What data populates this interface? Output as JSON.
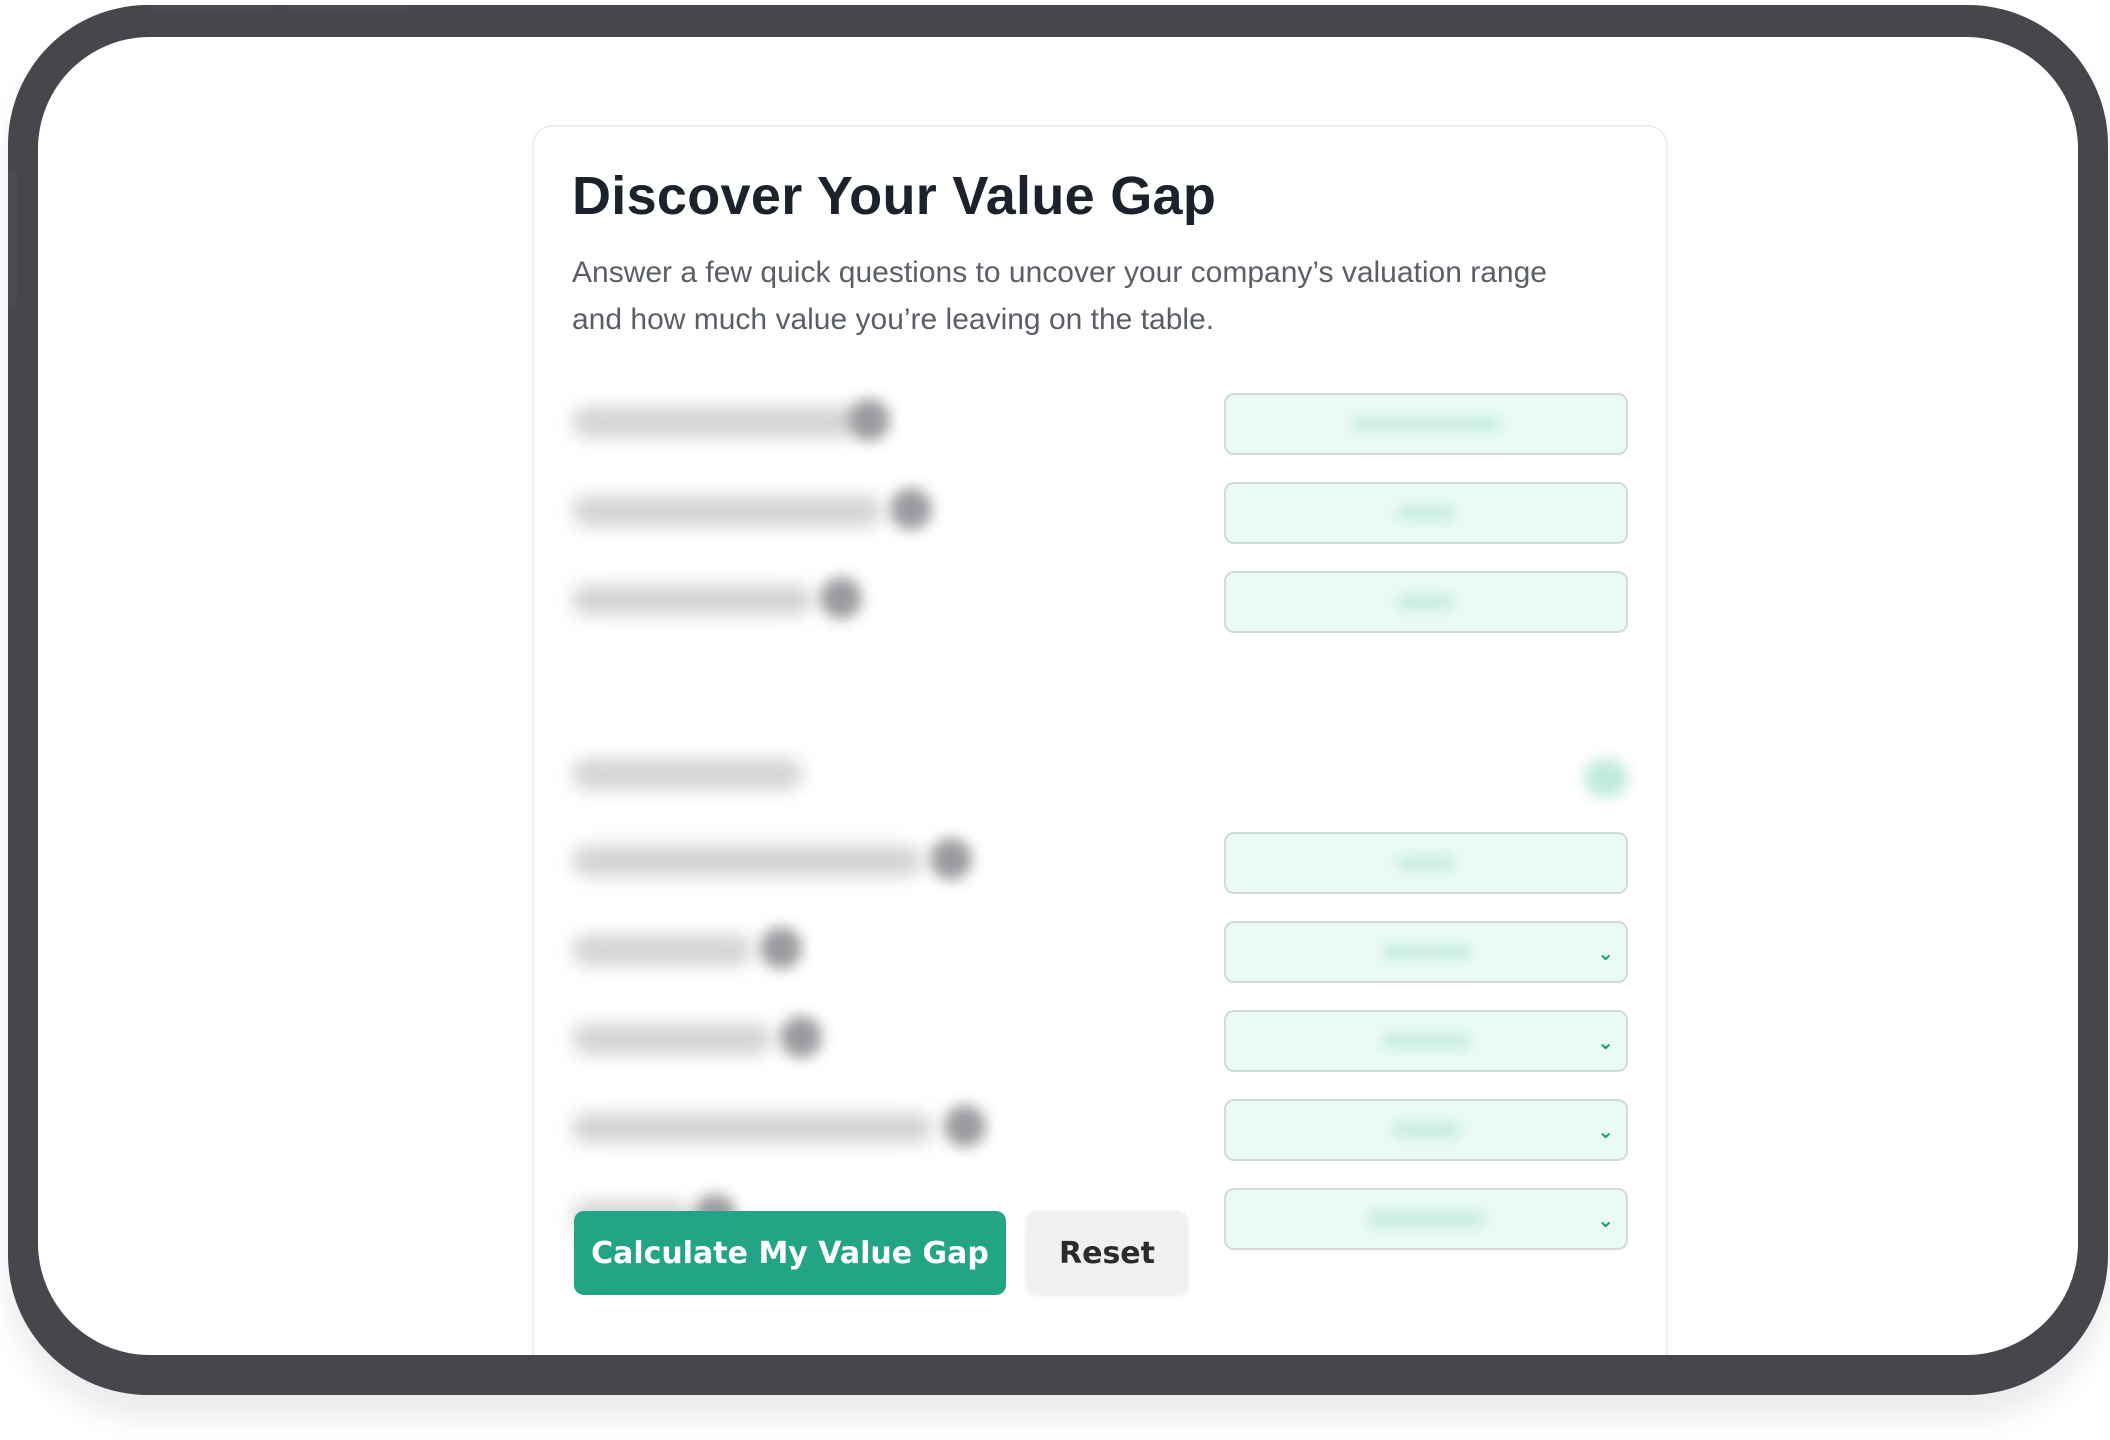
{
  "form": {
    "title": "Discover Your Value Gap",
    "subtitle": "Answer a few quick questions to uncover your company’s valuation range and how much value you’re leaving on the table."
  },
  "actions": {
    "calculate_label": "Calculate My Value Gap",
    "reset_label": "Reset"
  },
  "icons": {
    "info": "info-icon",
    "select_arrow": "chevron-down-icon"
  },
  "colors": {
    "accent": "#23a585",
    "field_bg": "#eafbf5",
    "device_frame": "#45474c"
  }
}
